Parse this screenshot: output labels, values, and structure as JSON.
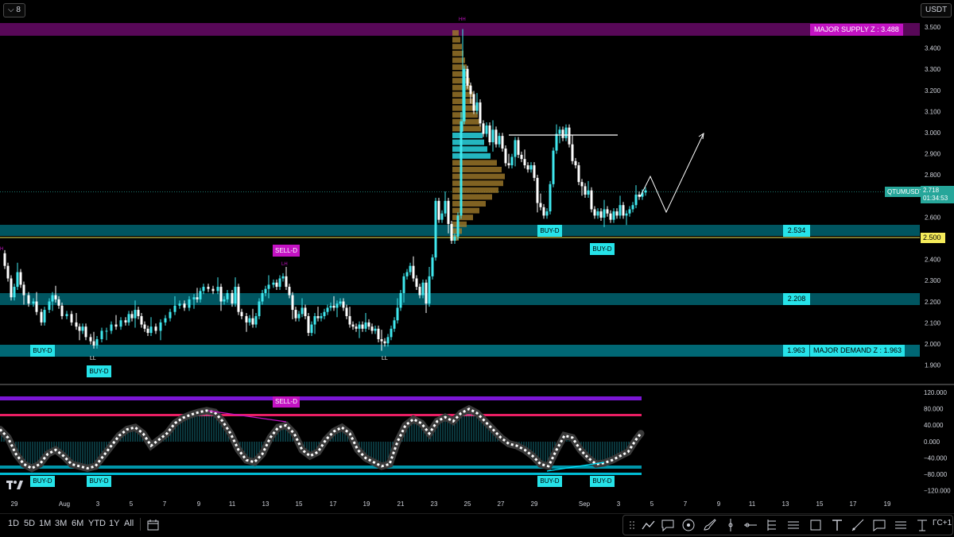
{
  "toolbar": {
    "symbol_chip": "8",
    "currency": "USDT",
    "timeframes": [
      "1D",
      "5D",
      "1M",
      "3M",
      "6M",
      "YTD",
      "1Y",
      "All"
    ],
    "right_label": "ΓC+1"
  },
  "price_axis": {
    "ticks": [
      "3.500",
      "3.400",
      "3.300",
      "3.200",
      "3.100",
      "3.000",
      "2.900",
      "2.800",
      "2.700",
      "2.600",
      "2.500",
      "2.400",
      "2.300",
      "2.200",
      "2.100",
      "2.000",
      "1.900"
    ],
    "current_symbol": "QTUMUSDT",
    "current_price": "2.718",
    "countdown": "01:34:53",
    "marker_2500": "2.500",
    "colors": {
      "current": "#26a69a",
      "yellow": "#f5eb5a",
      "zone": "#00bcd4"
    }
  },
  "osc_axis": {
    "ticks": [
      "120.000",
      "80.000",
      "40.000",
      "0.000",
      "−40.000",
      "−80.000",
      "−120.000"
    ]
  },
  "time_axis": {
    "labels": [
      "29",
      "Aug",
      "3",
      "5",
      "7",
      "9",
      "11",
      "13",
      "15",
      "17",
      "19",
      "21",
      "23",
      "25",
      "27",
      "29",
      "Sep",
      "3",
      "5",
      "7",
      "9",
      "11",
      "13",
      "15",
      "17",
      "19"
    ]
  },
  "zones": {
    "supply": {
      "label": "MAJOR SUPPLY Z : 3.488",
      "color": "#c312c3"
    },
    "z2534": {
      "label": "2.534"
    },
    "z2208": {
      "label": "2.208"
    },
    "z1963": {
      "label": "1.963"
    },
    "demand": {
      "label": "MAJOR DEMAND Z : 1.963"
    }
  },
  "annotations": {
    "buy": "BUY-D",
    "sell": "SELL-D",
    "ll": "LL",
    "hh": "HH",
    "lh": "LH",
    "h": "H"
  },
  "chart_data": {
    "type": "candlestick",
    "symbol": "QTUMUSDT",
    "ylim": [
      1.85,
      3.56
    ],
    "x": [
      "29",
      "Aug",
      "3",
      "5",
      "7",
      "9",
      "11",
      "13",
      "15",
      "17",
      "19",
      "21",
      "23",
      "25",
      "27",
      "29",
      "Sep",
      "3",
      "5"
    ],
    "levels": {
      "supply": 3.488,
      "r1": 2.534,
      "r2": 2.208,
      "demand": 1.963,
      "marker": 2.5,
      "current": 2.718,
      "line_3": 2.99
    },
    "oscillator": {
      "ylim": [
        -120,
        120
      ],
      "upper_band": 100,
      "upper_line": 64,
      "lower_line": -65,
      "lower_band": -78
    }
  }
}
